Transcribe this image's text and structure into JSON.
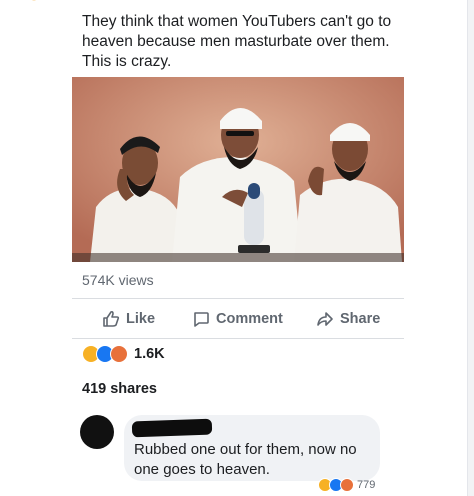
{
  "post": {
    "text": "They think that women YouTubers can't go to\nheaven because men masturbate over them.\nThis is crazy."
  },
  "video": {
    "views": "574K views"
  },
  "actions": {
    "like": "Like",
    "comment": "Comment",
    "share": "Share"
  },
  "stats": {
    "reaction_icons": [
      "haha-icon",
      "like-icon",
      "angry-icon"
    ],
    "reaction_count": "1.6K",
    "shares": "419 shares"
  },
  "comment": {
    "text": "Rubbed one out for them, now no\none goes to heaven.",
    "reaction_count": "779"
  },
  "colors": {
    "text": "#1c1e21",
    "secondary": "#606770",
    "like_blue": "#1877f2",
    "haha_yellow": "#f7b125",
    "angry_orange": "#e8713b",
    "bubble": "#f0f2f5"
  }
}
